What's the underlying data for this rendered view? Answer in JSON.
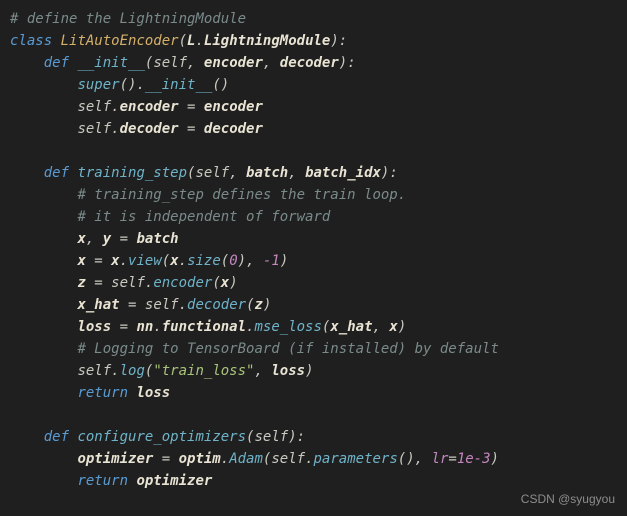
{
  "code": {
    "l1_comment": "# define the LightningModule",
    "l2_class": "class",
    "l2_name": "LitAutoEncoder",
    "l2_po": "(",
    "l2_base": "L",
    "l2_dot": ".",
    "l2_mod": "LightningModule",
    "l2_pc": "):",
    "l3_def": "def",
    "l3_fn": "__init__",
    "l3_po": "(",
    "l3_self": "self",
    "l3_c1": ", ",
    "l3_a1": "encoder",
    "l3_c2": ", ",
    "l3_a2": "decoder",
    "l3_pc": "):",
    "l4_super": "super",
    "l4_po": "().",
    "l4_init": "__init__",
    "l4_pc": "()",
    "l5_self": "self",
    "l5_dot": ".",
    "l5_a": "encoder",
    "l5_eq": " = ",
    "l5_b": "encoder",
    "l6_self": "self",
    "l6_dot": ".",
    "l6_a": "decoder",
    "l6_eq": " = ",
    "l6_b": "decoder",
    "l7_def": "def",
    "l7_fn": "training_step",
    "l7_po": "(",
    "l7_self": "self",
    "l7_c1": ", ",
    "l7_a1": "batch",
    "l7_c2": ", ",
    "l7_a2": "batch_idx",
    "l7_pc": "):",
    "l8_c": "# training_step defines the train loop.",
    "l9_c": "# it is independent of forward",
    "l10_x": "x",
    "l10_c": ", ",
    "l10_y": "y",
    "l10_eq": " = ",
    "l10_b": "batch",
    "l11_x1": "x",
    "l11_eq": " = ",
    "l11_x2": "x",
    "l11_d1": ".",
    "l11_view": "view",
    "l11_po": "(",
    "l11_x3": "x",
    "l11_d2": ".",
    "l11_size": "size",
    "l11_po2": "(",
    "l11_n0": "0",
    "l11_pc2": "), ",
    "l11_neg1": "-1",
    "l11_pc": ")",
    "l12_z": "z",
    "l12_eq": " = ",
    "l12_self": "self",
    "l12_d": ".",
    "l12_enc": "encoder",
    "l12_po": "(",
    "l12_x": "x",
    "l12_pc": ")",
    "l13_xh": "x_hat",
    "l13_eq": " = ",
    "l13_self": "self",
    "l13_d": ".",
    "l13_dec": "decoder",
    "l13_po": "(",
    "l13_z": "z",
    "l13_pc": ")",
    "l14_loss": "loss",
    "l14_eq": " = ",
    "l14_nn": "nn",
    "l14_d1": ".",
    "l14_f": "functional",
    "l14_d2": ".",
    "l14_mse": "mse_loss",
    "l14_po": "(",
    "l14_xh": "x_hat",
    "l14_c": ", ",
    "l14_x": "x",
    "l14_pc": ")",
    "l15_c": "# Logging to TensorBoard (if installed) by default",
    "l16_self": "self",
    "l16_d": ".",
    "l16_log": "log",
    "l16_po": "(",
    "l16_s": "\"train_loss\"",
    "l16_c": ", ",
    "l16_loss": "loss",
    "l16_pc": ")",
    "l17_ret": "return",
    "l17_loss": "loss",
    "l18_def": "def",
    "l18_fn": "configure_optimizers",
    "l18_po": "(",
    "l18_self": "self",
    "l18_pc": "):",
    "l19_opt": "optimizer",
    "l19_eq": " = ",
    "l19_optim": "optim",
    "l19_d": ".",
    "l19_adam": "Adam",
    "l19_po": "(",
    "l19_self": "self",
    "l19_d2": ".",
    "l19_params": "parameters",
    "l19_pc1": "(), ",
    "l19_lr": "lr",
    "l19_eq2": "=",
    "l19_num": "1e-3",
    "l19_pc": ")",
    "l20_ret": "return",
    "l20_opt": "optimizer"
  },
  "watermark": "CSDN @syugyou"
}
